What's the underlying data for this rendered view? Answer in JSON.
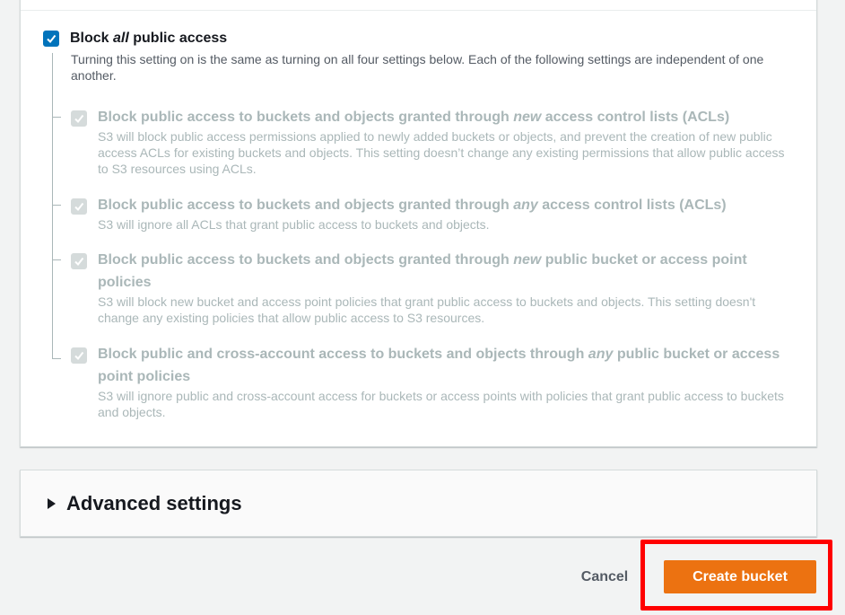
{
  "block_public_access": {
    "master": {
      "title_before": "Block ",
      "title_em": "all",
      "title_after": " public access",
      "checked": true,
      "description": "Turning this setting on is the same as turning on all four settings below. Each of the following settings are independent of one another."
    },
    "options": [
      {
        "title_before": "Block public access to buckets and objects granted through ",
        "title_em": "new",
        "title_after": " access control lists (ACLs)",
        "description": "S3 will block public access permissions applied to newly added buckets or objects, and prevent the creation of new public access ACLs for existing buckets and objects. This setting doesn’t change any existing permissions that allow public access to S3 resources using ACLs."
      },
      {
        "title_before": "Block public access to buckets and objects granted through ",
        "title_em": "any",
        "title_after": " access control lists (ACLs)",
        "description": "S3 will ignore all ACLs that grant public access to buckets and objects."
      },
      {
        "title_before": "Block public access to buckets and objects granted through ",
        "title_em": "new",
        "title_after": " public bucket or access point policies",
        "description": "S3 will block new bucket and access point policies that grant public access to buckets and objects. This setting doesn't change any existing policies that allow public access to S3 resources."
      },
      {
        "title_before": "Block public and cross-account access to buckets and objects through ",
        "title_em": "any",
        "title_after": " public bucket or access point policies",
        "description": "S3 will ignore public and cross-account access for buckets or access points with policies that grant public access to buckets and objects."
      }
    ]
  },
  "advanced_settings": {
    "label": "Advanced settings",
    "expanded": false
  },
  "footer": {
    "cancel_label": "Cancel",
    "create_label": "Create bucket"
  },
  "colors": {
    "primary_button": "#ec7211",
    "checkbox_checked": "#0073bb",
    "highlight": "#ff0000"
  }
}
